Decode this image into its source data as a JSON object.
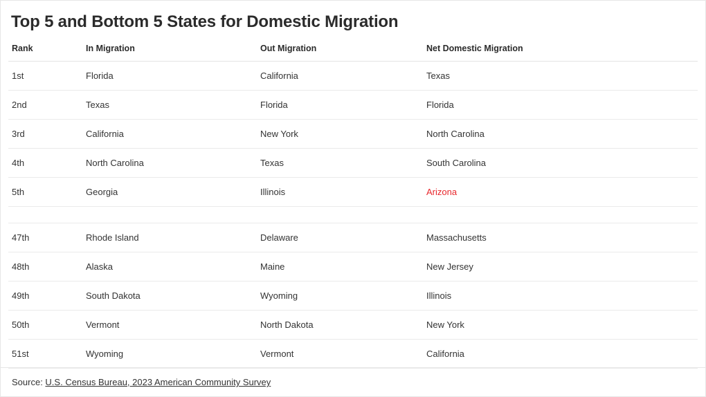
{
  "title": "Top 5 and Bottom 5 States for Domestic Migration",
  "table": {
    "columns": [
      "Rank",
      "In Migration",
      "Out Migration",
      "Net Domestic Migration"
    ],
    "rows": [
      {
        "rank": "1st",
        "in_migration": "Florida",
        "out_migration": "California",
        "net_domestic_migration": "Texas"
      },
      {
        "rank": "2nd",
        "in_migration": "Texas",
        "out_migration": "Florida",
        "net_domestic_migration": "Florida"
      },
      {
        "rank": "3rd",
        "in_migration": "California",
        "out_migration": "New York",
        "net_domestic_migration": "North Carolina"
      },
      {
        "rank": "4th",
        "in_migration": "North Carolina",
        "out_migration": "Texas",
        "net_domestic_migration": "South Carolina"
      },
      {
        "rank": "5th",
        "in_migration": "Georgia",
        "out_migration": "Illinois",
        "net_domestic_migration": "Arizona",
        "net_highlight": true
      },
      {
        "spacer": true
      },
      {
        "rank": "47th",
        "in_migration": "Rhode Island",
        "out_migration": "Delaware",
        "net_domestic_migration": "Massachusetts"
      },
      {
        "rank": "48th",
        "in_migration": "Alaska",
        "out_migration": "Maine",
        "net_domestic_migration": "New Jersey"
      },
      {
        "rank": "49th",
        "in_migration": "South Dakota",
        "out_migration": "Wyoming",
        "net_domestic_migration": "Illinois"
      },
      {
        "rank": "50th",
        "in_migration": "Vermont",
        "out_migration": "North Dakota",
        "net_domestic_migration": "New York"
      },
      {
        "rank": "51st",
        "in_migration": "Wyoming",
        "out_migration": "Vermont",
        "net_domestic_migration": "California"
      }
    ]
  },
  "footer": {
    "source_label": "Source: ",
    "source_link": "U.S. Census Bureau, 2023 American Community Survey"
  },
  "colors": {
    "highlight": "#e8272c",
    "text": "#333333",
    "heading": "#2b2b2b",
    "rule": "#eaeaea",
    "border": "#e6e6e6"
  }
}
